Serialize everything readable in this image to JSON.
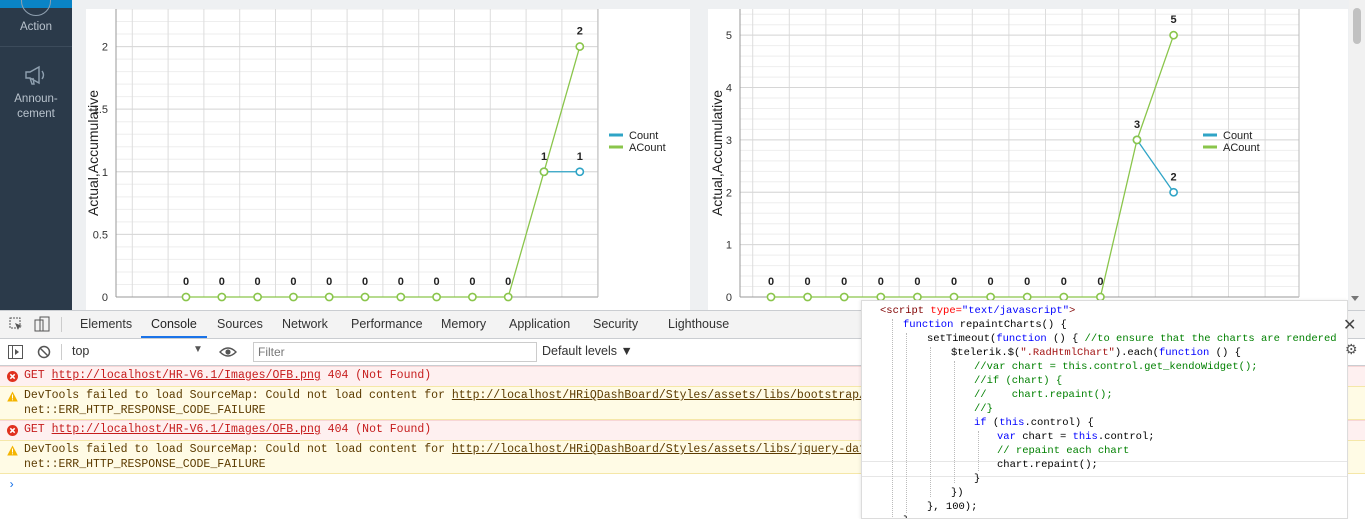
{
  "sidebar": {
    "items": [
      {
        "label": "Action",
        "icon": "action-icon"
      },
      {
        "label_lines": [
          "Announ-",
          "cement"
        ],
        "icon": "megaphone-icon"
      }
    ]
  },
  "charts": [
    {
      "ylabel": "Actual,Accumulative",
      "yticks": [
        "0",
        "0.5",
        "1",
        "1.5",
        "2"
      ],
      "legend": [
        {
          "name": "Count",
          "color": "#2fa4c6"
        },
        {
          "name": "ACount",
          "color": "#8ac54b"
        }
      ]
    },
    {
      "ylabel": "Actual,Accumulative",
      "yticks": [
        "0",
        "1",
        "2",
        "3",
        "4",
        "5"
      ],
      "legend": [
        {
          "name": "Count",
          "color": "#2fa4c6"
        },
        {
          "name": "ACount",
          "color": "#8ac54b"
        }
      ]
    }
  ],
  "chart_data": [
    {
      "type": "line",
      "ylabel": "Actual,Accumulative",
      "ylim": [
        0,
        2.3
      ],
      "x": [
        0,
        1,
        2,
        3,
        4,
        5,
        6,
        7,
        8,
        9,
        10,
        11
      ],
      "series": [
        {
          "name": "Count",
          "color": "#2fa4c6",
          "values": [
            null,
            null,
            null,
            null,
            null,
            null,
            null,
            null,
            null,
            null,
            1,
            1
          ],
          "labels": [
            "",
            "",
            "",
            "",
            "",
            "",
            "",
            "",
            "",
            "",
            "",
            "1"
          ]
        },
        {
          "name": "ACount",
          "color": "#8ac54b",
          "values": [
            0,
            0,
            0,
            0,
            0,
            0,
            0,
            0,
            0,
            0,
            1,
            2
          ],
          "labels": [
            "0",
            "0",
            "0",
            "0",
            "0",
            "0",
            "0",
            "0",
            "0",
            "0",
            "1",
            "2"
          ]
        }
      ],
      "grid": true,
      "legend_position": "right"
    },
    {
      "type": "line",
      "ylabel": "Actual,Accumulative",
      "ylim": [
        0,
        5.5
      ],
      "x": [
        0,
        1,
        2,
        3,
        4,
        5,
        6,
        7,
        8,
        9,
        10,
        11
      ],
      "series": [
        {
          "name": "Count",
          "color": "#2fa4c6",
          "values": [
            null,
            null,
            null,
            null,
            null,
            null,
            null,
            null,
            null,
            null,
            3,
            2
          ],
          "labels": [
            "",
            "",
            "",
            "",
            "",
            "",
            "",
            "",
            "",
            "",
            "",
            "2"
          ]
        },
        {
          "name": "ACount",
          "color": "#8ac54b",
          "values": [
            0,
            0,
            0,
            0,
            0,
            0,
            0,
            0,
            0,
            0,
            3,
            5
          ],
          "labels": [
            "0",
            "0",
            "0",
            "0",
            "0",
            "0",
            "0",
            "0",
            "0",
            "0",
            "3",
            "5"
          ]
        }
      ],
      "grid": true,
      "legend_position": "right"
    }
  ],
  "devtools": {
    "tabs": [
      "Elements",
      "Console",
      "Sources",
      "Network",
      "Performance",
      "Memory",
      "Application",
      "Security",
      "Lighthouse"
    ],
    "active_tab": "Console",
    "context": "top",
    "filter_placeholder": "Filter",
    "levels": "Default levels ▼",
    "messages": [
      {
        "type": "error",
        "pre": "GET ",
        "link": "http://localhost/HR-V6.1/Images/OFB.png",
        "post": " 404 (Not Found)"
      },
      {
        "type": "warning",
        "pre": "DevTools failed to load SourceMap: Could not load content for ",
        "link": "http://localhost/HRiQDashBoard/Styles/assets/libs/bootstrap/css/b",
        "line2": "net::ERR_HTTP_RESPONSE_CODE_FAILURE"
      },
      {
        "type": "error",
        "pre": "GET ",
        "link": "http://localhost/HR-V6.1/Images/OFB.png",
        "post": " 404 (Not Found)"
      },
      {
        "type": "warning",
        "pre": "DevTools failed to load SourceMap: Could not load content for ",
        "link": "http://localhost/HRiQDashBoard/Styles/assets/libs/jquery-datatabl",
        "line2": "net::ERR_HTTP_RESPONSE_CODE_FAILURE"
      }
    ],
    "prompt": "›"
  },
  "code": {
    "l0a": "<script",
    "l0b": " type=",
    "l0c": "\"text/javascript\"",
    "l0d": ">",
    "l1a": "function",
    "l1b": " repaintCharts() {",
    "l2a": "setTimeout(",
    "l2b": "function",
    "l2c": " () { ",
    "l2d": "//to ensure that the charts are rendered",
    "l3a": "$telerik.$(",
    "l3b": "\".RadHtmlChart\"",
    "l3c": ").each(",
    "l3d": "function",
    "l3e": " () {",
    "l4": "//var chart = this.control.get_kendoWidget();",
    "l5": "//if (chart) {",
    "l6": "//    chart.repaint();",
    "l7": "//}",
    "l8a": "if",
    "l8b": " (",
    "l8c": "this",
    "l8d": ".control) {",
    "l9a": "var",
    "l9b": " chart = ",
    "l9c": "this",
    "l9d": ".control;",
    "l10": "// repaint each chart",
    "l11": "chart.repaint();",
    "l12": "}",
    "l13": "})",
    "l14": "}, 100);",
    "l15": "}"
  }
}
